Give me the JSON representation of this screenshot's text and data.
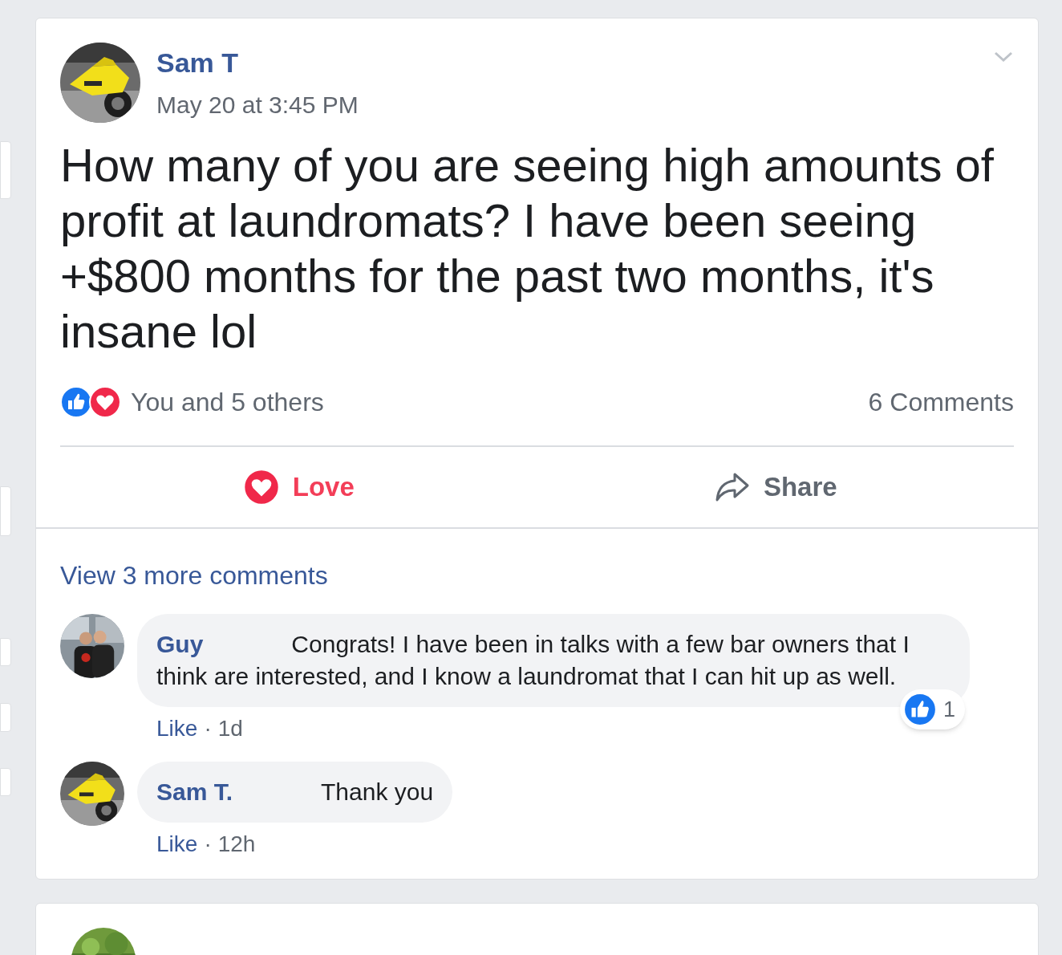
{
  "post": {
    "author": "Sam T",
    "timestamp": "May 20 at 3:45 PM",
    "text": "How many of you are seeing high amounts of profit at laundromats? I have been seeing +$800 months for the past two months, it's insane lol",
    "reactions_summary": "You and 5 others",
    "comments_count": "6 Comments",
    "actions": [
      {
        "kind": "love",
        "label": "Love",
        "selected": true
      },
      {
        "kind": "share",
        "label": "Share",
        "selected": false
      }
    ]
  },
  "view_more": "View 3 more comments",
  "comments": [
    {
      "author": "Guy",
      "text": "Congrats! I have been in talks with a few bar owners that I think are interested, and I know a laundromat that I can hit up as well.",
      "like": "Like",
      "separator": "·",
      "time": "1d",
      "reaction_count": "1"
    },
    {
      "author": "Sam T.",
      "text": "Thank you",
      "like": "Like",
      "separator": "·",
      "time": "12h"
    }
  ]
}
